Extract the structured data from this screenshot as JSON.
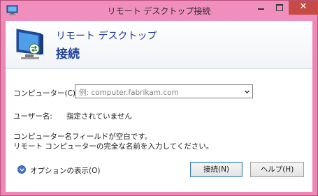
{
  "window": {
    "title": "リモート デスクトップ接続",
    "controls": {
      "close_glyph": "✕"
    }
  },
  "banner": {
    "line1": "リモート デスクトップ",
    "line2": "接続"
  },
  "form": {
    "computer_label": "コンピューター(C):",
    "computer_placeholder": "例: computer.fabrikam.com",
    "username_label": "ユーザー名:",
    "username_value": "指定されていません",
    "message_line1": "コンピューター名フィールドが空白です。",
    "message_line2": "リモート コンピューターの完全な名前を入力してください。"
  },
  "footer": {
    "options_label": "オプションの表示(O)",
    "connect_label": "接続(N)",
    "help_label": "ヘルプ(H)"
  },
  "colors": {
    "titlebar": "#f08fbd",
    "close": "#c74a44",
    "banner_text": "#1f3f9a"
  }
}
